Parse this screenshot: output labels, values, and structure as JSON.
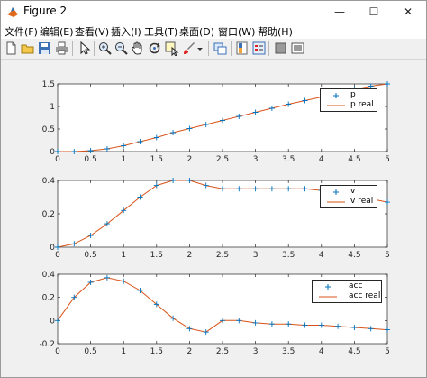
{
  "window": {
    "title": "Figure 2",
    "controls": [
      "—",
      "☐",
      "✕"
    ]
  },
  "menu": [
    "文件(F)",
    "编辑(E)",
    "查看(V)",
    "插入(I)",
    "工具(T)",
    "桌面(D)",
    "窗口(W)",
    "帮助(H)"
  ],
  "toolbar": [
    "new-figure",
    "open-file",
    "save",
    "print",
    "edit-plot",
    "zoom-in",
    "zoom-out",
    "pan",
    "rotate-3d",
    "data-cursor",
    "brush",
    "link-plot",
    "insert-colorbar",
    "insert-legend",
    "hide-plot-tools",
    "show-plot-tools"
  ],
  "colors": {
    "marker": "#0072BD",
    "line": "#D95319"
  },
  "chart_data": [
    {
      "type": "line",
      "xlim": [
        0,
        5
      ],
      "ylim": [
        0,
        1.5
      ],
      "xticks": [
        "0",
        "0.5",
        "1",
        "1.5",
        "2",
        "2.5",
        "3",
        "3.5",
        "4",
        "4.5",
        "5"
      ],
      "yticks": [
        "0",
        "0.5",
        "1",
        "1.5"
      ],
      "x": [
        0,
        0.25,
        0.5,
        0.75,
        1,
        1.25,
        1.5,
        1.75,
        2,
        2.25,
        2.5,
        2.75,
        3,
        3.25,
        3.5,
        3.75,
        4,
        4.25,
        4.5,
        4.75,
        5
      ],
      "series": [
        {
          "name": "p",
          "style": "markers",
          "values": [
            0,
            0,
            0.02,
            0.06,
            0.13,
            0.22,
            0.31,
            0.42,
            0.51,
            0.6,
            0.69,
            0.78,
            0.87,
            0.96,
            1.05,
            1.13,
            1.21,
            1.3,
            1.38,
            1.45,
            1.5
          ]
        },
        {
          "name": "p real",
          "style": "line",
          "values": [
            0,
            0,
            0.02,
            0.06,
            0.13,
            0.22,
            0.31,
            0.42,
            0.51,
            0.6,
            0.69,
            0.78,
            0.87,
            0.96,
            1.05,
            1.13,
            1.21,
            1.3,
            1.38,
            1.45,
            1.5
          ]
        }
      ]
    },
    {
      "type": "line",
      "xlim": [
        0,
        5
      ],
      "ylim": [
        0,
        0.4
      ],
      "xticks": [
        "0",
        "0.5",
        "1",
        "1.5",
        "2",
        "2.5",
        "3",
        "3.5",
        "4",
        "4.5",
        "5"
      ],
      "yticks": [
        "0",
        "0.2",
        "0.4"
      ],
      "x": [
        0,
        0.25,
        0.5,
        0.75,
        1,
        1.25,
        1.5,
        1.75,
        2,
        2.25,
        2.5,
        2.75,
        3,
        3.25,
        3.5,
        3.75,
        4,
        4.25,
        4.5,
        4.75,
        5
      ],
      "series": [
        {
          "name": "v",
          "style": "markers",
          "values": [
            0,
            0.02,
            0.07,
            0.14,
            0.22,
            0.3,
            0.37,
            0.4,
            0.4,
            0.37,
            0.35,
            0.35,
            0.35,
            0.35,
            0.35,
            0.35,
            0.34,
            0.33,
            0.31,
            0.29,
            0.27
          ]
        },
        {
          "name": "v real",
          "style": "line",
          "values": [
            0,
            0.02,
            0.07,
            0.14,
            0.22,
            0.3,
            0.37,
            0.4,
            0.4,
            0.37,
            0.35,
            0.35,
            0.35,
            0.35,
            0.35,
            0.35,
            0.34,
            0.33,
            0.31,
            0.29,
            0.27
          ]
        }
      ]
    },
    {
      "type": "line",
      "xlim": [
        0,
        5
      ],
      "ylim": [
        -0.2,
        0.4
      ],
      "xticks": [
        "0",
        "0.5",
        "1",
        "1.5",
        "2",
        "2.5",
        "3",
        "3.5",
        "4",
        "4.5",
        "5"
      ],
      "yticks": [
        "-0.2",
        "0",
        "0.2",
        "0.4"
      ],
      "x": [
        0,
        0.25,
        0.5,
        0.75,
        1,
        1.25,
        1.5,
        1.75,
        2,
        2.25,
        2.5,
        2.75,
        3,
        3.25,
        3.5,
        3.75,
        4,
        4.25,
        4.5,
        4.75,
        5
      ],
      "series": [
        {
          "name": "acc",
          "style": "markers",
          "values": [
            0,
            0.2,
            0.33,
            0.37,
            0.34,
            0.26,
            0.14,
            0.02,
            -0.07,
            -0.1,
            0.0,
            0.0,
            -0.02,
            -0.03,
            -0.03,
            -0.04,
            -0.04,
            -0.05,
            -0.06,
            -0.07,
            -0.08
          ]
        },
        {
          "name": "acc real",
          "style": "line",
          "values": [
            0,
            0.2,
            0.33,
            0.37,
            0.34,
            0.26,
            0.14,
            0.02,
            -0.07,
            -0.1,
            0.0,
            0.0,
            -0.02,
            -0.03,
            -0.03,
            -0.04,
            -0.04,
            -0.05,
            -0.06,
            -0.07,
            -0.08
          ]
        }
      ]
    }
  ]
}
